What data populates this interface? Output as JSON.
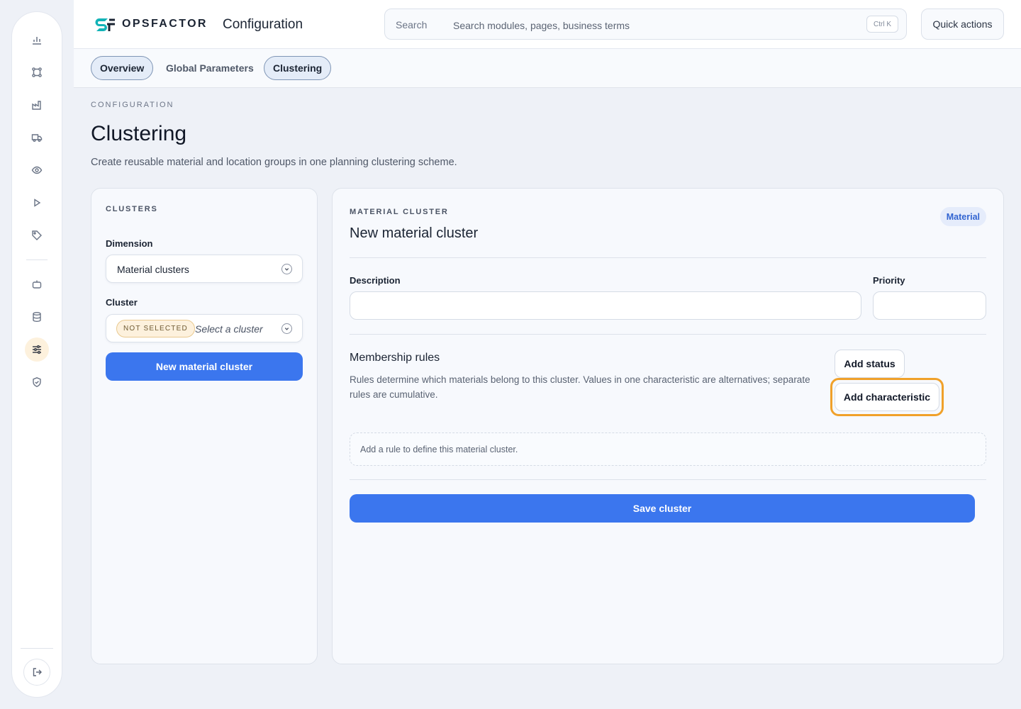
{
  "app": {
    "logo_text": "OPSFACTOR",
    "header_title": "Configuration"
  },
  "search": {
    "label": "Search",
    "placeholder": "Search modules, pages, business terms",
    "shortcut": "Ctrl K"
  },
  "header": {
    "quick_actions": "Quick actions"
  },
  "sidebar": {
    "items": [
      {
        "icon": "bar-chart-icon"
      },
      {
        "icon": "network-nodes-icon"
      },
      {
        "icon": "factory-icon"
      },
      {
        "icon": "truck-icon"
      },
      {
        "icon": "eye-icon"
      },
      {
        "icon": "play-icon"
      },
      {
        "icon": "tag-icon"
      },
      {
        "icon": "robot-icon"
      },
      {
        "icon": "database-icon"
      },
      {
        "icon": "sliders-icon",
        "active": true
      },
      {
        "icon": "shield-check-icon"
      }
    ],
    "logout_icon": "logout-icon"
  },
  "tabs": [
    {
      "label": "Overview",
      "style": "pill"
    },
    {
      "label": "Global Parameters",
      "style": "plain"
    },
    {
      "label": "Clustering",
      "style": "pill"
    }
  ],
  "page": {
    "eyebrow": "CONFIGURATION",
    "title": "Clustering",
    "subtitle": "Create reusable material and location groups in one planning clustering scheme."
  },
  "clusters_panel": {
    "eyebrow": "CLUSTERS",
    "dimension_label": "Dimension",
    "dimension_value": "Material clusters",
    "cluster_label": "Cluster",
    "cluster_badge": "NOT SELECTED",
    "cluster_placeholder": "Select a cluster",
    "new_button": "New material cluster"
  },
  "detail": {
    "eyebrow": "MATERIAL CLUSTER",
    "badge": "Material",
    "title": "New material cluster",
    "description_label": "Description",
    "description_value": "",
    "priority_label": "Priority",
    "priority_value": "",
    "rules_title": "Membership rules",
    "rules_desc": "Rules determine which materials belong to this cluster. Values in one characteristic are alternatives; separate rules are cumulative.",
    "add_status": "Add status",
    "add_characteristic": "Add characteristic",
    "empty_rules": "Add a rule to define this material cluster.",
    "save_button": "Save cluster"
  },
  "colors": {
    "primary": "#3b76ee",
    "focus_ring": "#f0a12a",
    "badge_warn_bg": "#fdf1dd",
    "badge_info_bg": "#e5ecfb"
  }
}
